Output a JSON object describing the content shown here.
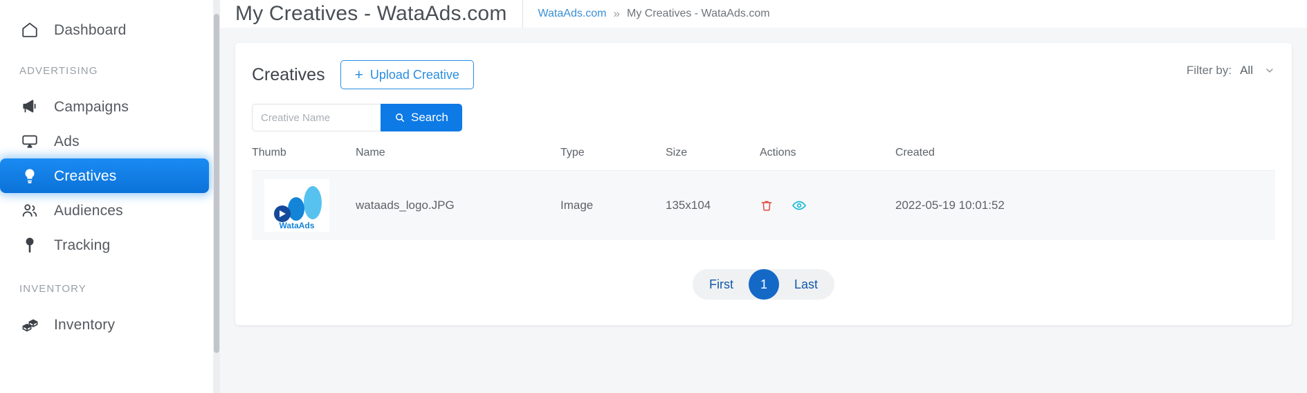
{
  "sidebar": {
    "items": [
      {
        "label": "Dashboard",
        "icon": "home-icon",
        "key": "dashboard",
        "active": false
      },
      {
        "label": "Campaigns",
        "icon": "megaphone-icon",
        "key": "campaigns",
        "active": false
      },
      {
        "label": "Ads",
        "icon": "monitor-icon",
        "key": "ads",
        "active": false
      },
      {
        "label": "Creatives",
        "icon": "lightbulb-icon",
        "key": "creatives",
        "active": true
      },
      {
        "label": "Audiences",
        "icon": "people-icon",
        "key": "audiences",
        "active": false
      },
      {
        "label": "Tracking",
        "icon": "pin-icon",
        "key": "tracking",
        "active": false
      },
      {
        "label": "Inventory",
        "icon": "boxes-icon",
        "key": "inventory",
        "active": false
      }
    ],
    "sections": {
      "advertising": "ADVERTISING",
      "inventory": "INVENTORY"
    }
  },
  "header": {
    "page_title": "My Creatives - WataAds.com",
    "breadcrumb": {
      "home": "WataAds.com",
      "separator": "»",
      "current": "My Creatives - WataAds.com"
    }
  },
  "card": {
    "title": "Creatives",
    "upload_button": {
      "plus": "+",
      "label": "Upload Creative"
    },
    "filter": {
      "label": "Filter by:",
      "value": "All",
      "icon": "chevron-down-icon"
    },
    "search": {
      "placeholder": "Creative Name",
      "value": "",
      "button_label": "Search",
      "button_icon": "search-icon"
    }
  },
  "table": {
    "columns": [
      "Thumb",
      "Name",
      "Type",
      "Size",
      "Actions",
      "Created"
    ],
    "rows": [
      {
        "thumb_alt": "wataads-logo-thumbnail",
        "thumb_caption": "WataAds",
        "name": "wataads_logo.JPG",
        "type": "Image",
        "size": "135x104",
        "actions": [
          {
            "name": "delete-action",
            "icon": "trash-icon",
            "color": "#e2483f"
          },
          {
            "name": "view-action",
            "icon": "eye-icon",
            "color": "#14b9d5"
          }
        ],
        "created": "2022-05-19 10:01:52"
      }
    ]
  },
  "pagination": {
    "first": "First",
    "current": "1",
    "last": "Last"
  },
  "colors": {
    "accent_blue": "#0d7ae6",
    "active_nav": "#1a8bf2",
    "link_blue": "#3a8fd4",
    "delete_red": "#e2483f",
    "view_cyan": "#14b9d5",
    "pager_blue": "#1469c7"
  }
}
